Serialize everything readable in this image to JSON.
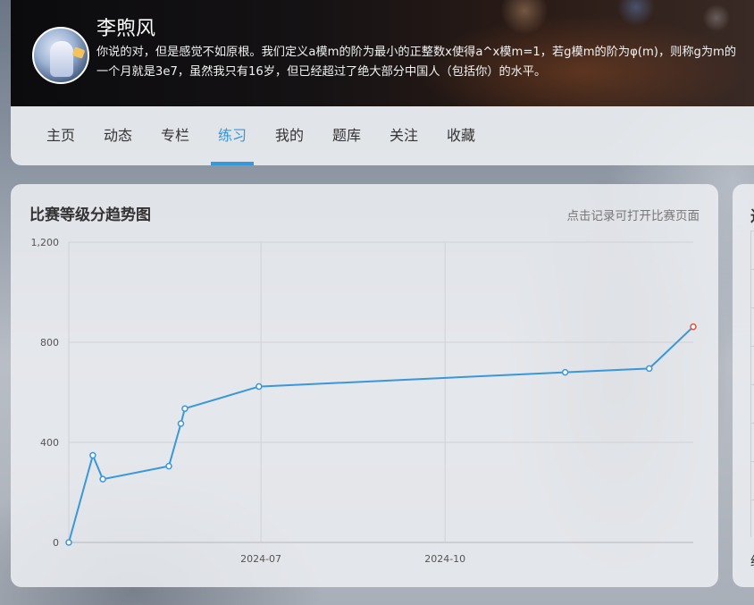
{
  "profile": {
    "name": "李煦风",
    "bio_line1": "你说的对，但是感觉不如原根。我们定义a模m的阶为最小的正整数x使得a^x模m=1，若g模m的阶为φ(m)，则称g为m的",
    "bio_line2": "一个月就是3e7，虽然我只有16岁，但已经超过了绝大部分中国人（包括你）的水平。"
  },
  "nav": {
    "tabs": [
      "主页",
      "动态",
      "专栏",
      "练习",
      "我的",
      "题库",
      "关注",
      "收藏"
    ],
    "active_index": 3
  },
  "card": {
    "title": "比赛等级分趋势图",
    "hint": "点击记录可打开比赛页面"
  },
  "side_card": {
    "title_fragment": "过",
    "footer_fragment": "约"
  },
  "colors": {
    "accent": "#3498db",
    "line": "#3a97d9",
    "last_point": "#e84c3d"
  },
  "chart_data": {
    "type": "line",
    "title": "",
    "xlabel": "",
    "ylabel": "",
    "ylim": [
      0,
      1200
    ],
    "yticks": [
      0,
      400,
      800,
      1200
    ],
    "ytick_labels": [
      "0",
      "400",
      "800",
      "1,200"
    ],
    "xlim": [
      "2024-03-27",
      "2025-02-02"
    ],
    "xticks": [
      "2024-07-01",
      "2024-10-01"
    ],
    "xtick_labels": [
      "2024-07",
      "2024-10"
    ],
    "grid": true,
    "series": [
      {
        "points": [
          {
            "x": "2024-03-27",
            "y": 0
          },
          {
            "x": "2024-04-08",
            "y": 348
          },
          {
            "x": "2024-04-13",
            "y": 253
          },
          {
            "x": "2024-05-16",
            "y": 305
          },
          {
            "x": "2024-05-22",
            "y": 475
          },
          {
            "x": "2024-05-24",
            "y": 535
          },
          {
            "x": "2024-06-30",
            "y": 623
          },
          {
            "x": "2024-11-30",
            "y": 680
          },
          {
            "x": "2025-01-11",
            "y": 695
          },
          {
            "x": "2025-02-02",
            "y": 862
          }
        ]
      }
    ]
  }
}
